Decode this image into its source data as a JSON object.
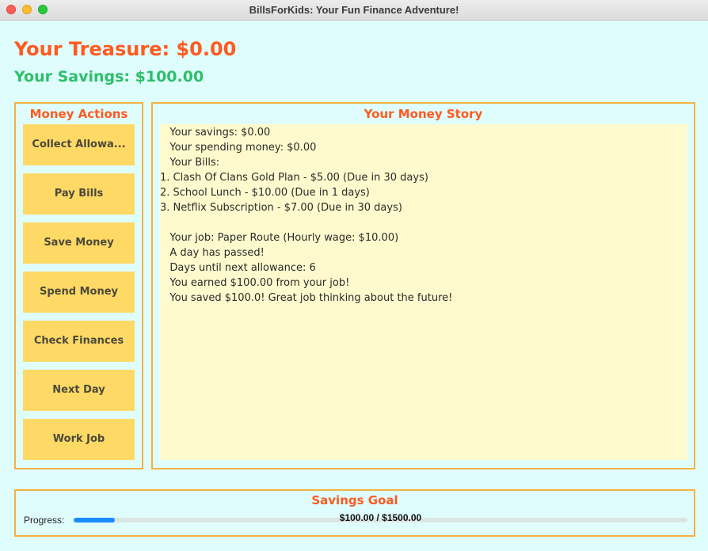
{
  "window": {
    "title": "BillsForKids: Your Fun Finance Adventure!"
  },
  "header": {
    "treasure": "Your Treasure: $0.00",
    "savings": "Your Savings: $100.00"
  },
  "actions": {
    "title": "Money Actions",
    "buttons": [
      "Collect Allowa...",
      "Pay Bills",
      "Save Money",
      "Spend Money",
      "Check Finances",
      "Next Day",
      "Work Job"
    ]
  },
  "story": {
    "title": "Your Money Story",
    "lines": [
      "   Your savings: $0.00",
      "   Your spending money: $0.00",
      "   Your Bills:",
      "1. Clash Of Clans Gold Plan - $5.00 (Due in 30 days)",
      "2. School Lunch - $10.00 (Due in 1 days)",
      "3. Netflix Subscription - $7.00 (Due in 30 days)",
      "",
      "   Your job: Paper Route (Hourly wage: $10.00)",
      "   A day has passed!",
      "   Days until next allowance: 6",
      "   You earned $100.00 from your job!",
      "   You saved $100.0! Great job thinking about the future!"
    ]
  },
  "goal": {
    "title": "Savings Goal",
    "progress_label": "Progress:",
    "progress_text": "$100.00 / $1500.00",
    "progress_fraction": 0.0667
  },
  "colors": {
    "background": "#e0fdfd",
    "accent_orange": "#ff5a1f",
    "savings_green": "#2dbf6a",
    "button_yellow": "#ffd966",
    "panel_border": "#f5b043",
    "story_bg": "#fffacd",
    "progress_blue": "#1a8cff"
  }
}
